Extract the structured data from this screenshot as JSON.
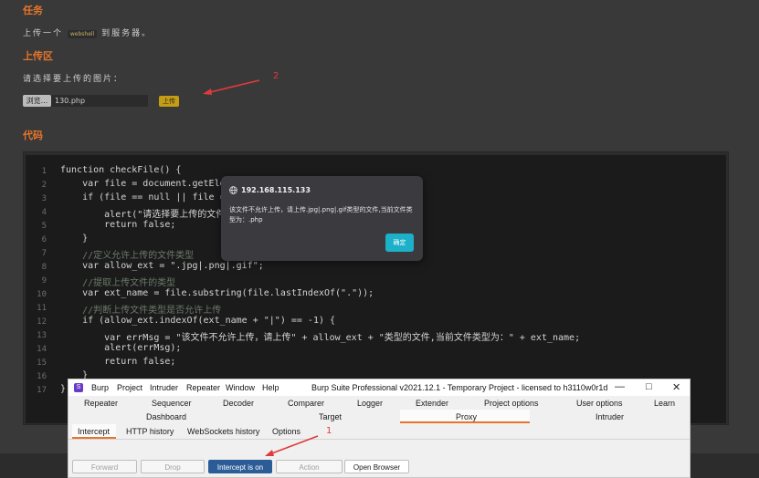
{
  "page": {
    "task_title": "任务",
    "task_text_pre": "上传一个",
    "task_tag": "webshell",
    "task_text_post": "到服务器。",
    "upload_title": "上传区",
    "upload_prompt": "请选择要上传的图片：",
    "browse_label": "浏览...",
    "file_name": "130.php",
    "upload_label": "上传",
    "code_title": "代码"
  },
  "annotations": {
    "one": "1",
    "two": "2"
  },
  "code": {
    "line_numbers": [
      "1",
      "2",
      "3",
      "4",
      "5",
      "6",
      "7",
      "8",
      "9",
      "10",
      "11",
      "12",
      "13",
      "14",
      "15",
      "16",
      "17"
    ],
    "lines": [
      "function checkFile() {",
      "    var file = document.getElem",
      "    if (file == null || file ==",
      "        alert(\"请选择要上传的文件",
      "        return false;",
      "    }",
      "    //定义允许上传的文件类型",
      "    var allow_ext = \".jpg|.png|.gif\";",
      "    //提取上传文件的类型",
      "    var ext_name = file.substring(file.lastIndexOf(\".\"));",
      "    //判断上传文件类型是否允许上传",
      "    if (allow_ext.indexOf(ext_name + \"|\") == -1) {",
      "        var errMsg = \"该文件不允许上传，请上传\" + allow_ext + \"类型的文件,当前文件类型为：\" + ext_name;",
      "        alert(errMsg);",
      "        return false;",
      "    }",
      "}"
    ]
  },
  "dialog": {
    "host": "192.168.115.133",
    "message": "该文件不允许上传，请上传.jpg|.png|.gif类型的文件,当前文件类型为：.php",
    "ok_label": "确定"
  },
  "burp": {
    "logo": "S",
    "menu": [
      "Burp",
      "Project",
      "Intruder",
      "Repeater",
      "Window",
      "Help"
    ],
    "caption": "Burp Suite Professional v2021.12.1 - Temporary Project - licensed to h3110w0r1d",
    "tabs_row1": [
      "Repeater",
      "Sequencer",
      "Decoder",
      "Comparer",
      "Logger",
      "Extender",
      "Project options",
      "User options",
      "Learn"
    ],
    "tabs_row2": [
      "Dashboard",
      "Target",
      "Proxy",
      "Intruder"
    ],
    "subtabs": [
      "Intercept",
      "HTTP history",
      "WebSockets history",
      "Options"
    ],
    "buttons": {
      "forward": "Forward",
      "drop": "Drop",
      "intercept": "Intercept is on",
      "action": "Action",
      "open_browser": "Open Browser"
    }
  }
}
